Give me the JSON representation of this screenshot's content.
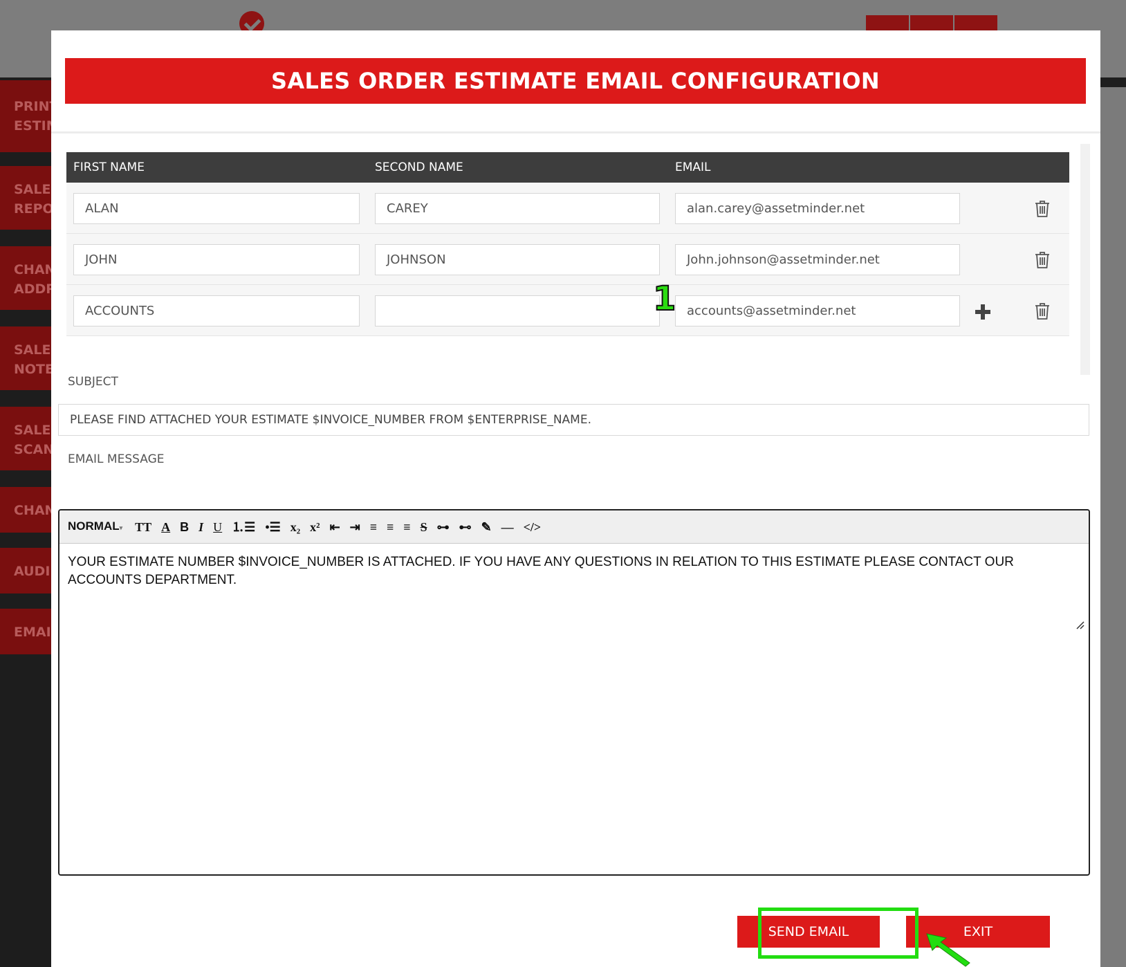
{
  "sidebar": {
    "items": [
      {
        "label": "PRINT\nESTIM"
      },
      {
        "label": "SALES\nREPO"
      },
      {
        "label": "CHAN\nADDR"
      },
      {
        "label": "SALES\nNOTE"
      },
      {
        "label": "SALES\nSCAN"
      },
      {
        "label": "CHAN"
      },
      {
        "label": "AUDI"
      },
      {
        "label": "EMAI"
      }
    ]
  },
  "modal": {
    "title": "SALES ORDER ESTIMATE EMAIL CONFIGURATION",
    "recipients": {
      "headers": {
        "first_name": "FIRST NAME",
        "second_name": "SECOND NAME",
        "email": "EMAIL"
      },
      "rows": [
        {
          "first_name": "ALAN",
          "second_name": "CAREY",
          "email": "alan.carey@assetminder.net"
        },
        {
          "first_name": "JOHN",
          "second_name": "JOHNSON",
          "email": "John.johnson@assetminder.net"
        },
        {
          "first_name": "ACCOUNTS",
          "second_name": "",
          "email": "accounts@assetminder.net"
        }
      ]
    },
    "annotation_marker": "1",
    "subject": {
      "label": "SUBJECT",
      "value": "PLEASE FIND ATTACHED YOUR ESTIMATE $INVOICE_NUMBER FROM $ENTERPRISE_NAME."
    },
    "email_message": {
      "label": "EMAIL MESSAGE",
      "format": "NORMAL",
      "body": "YOUR ESTIMATE NUMBER $INVOICE_NUMBER IS ATTACHED. IF YOU HAVE ANY QUESTIONS IN RELATION TO THIS ESTIMATE PLEASE CONTACT OUR ACCOUNTS DEPARTMENT."
    },
    "buttons": {
      "send": "SEND EMAIL",
      "exit": "EXIT"
    }
  },
  "colors": {
    "brand_red": "#dc1a1a",
    "header_dark": "#3d3d3d",
    "highlight_green": "#22dd11"
  }
}
